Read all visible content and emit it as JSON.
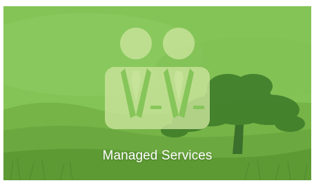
{
  "card": {
    "title": "Managed Services",
    "icon": "business-people-icon",
    "background": "green-tinted meadow with tree",
    "colors": {
      "overlay": "#7dbd4f",
      "icon_fill": "#c9e39b",
      "tree": "#3f7d2a",
      "title_text": "#ffffff"
    }
  }
}
